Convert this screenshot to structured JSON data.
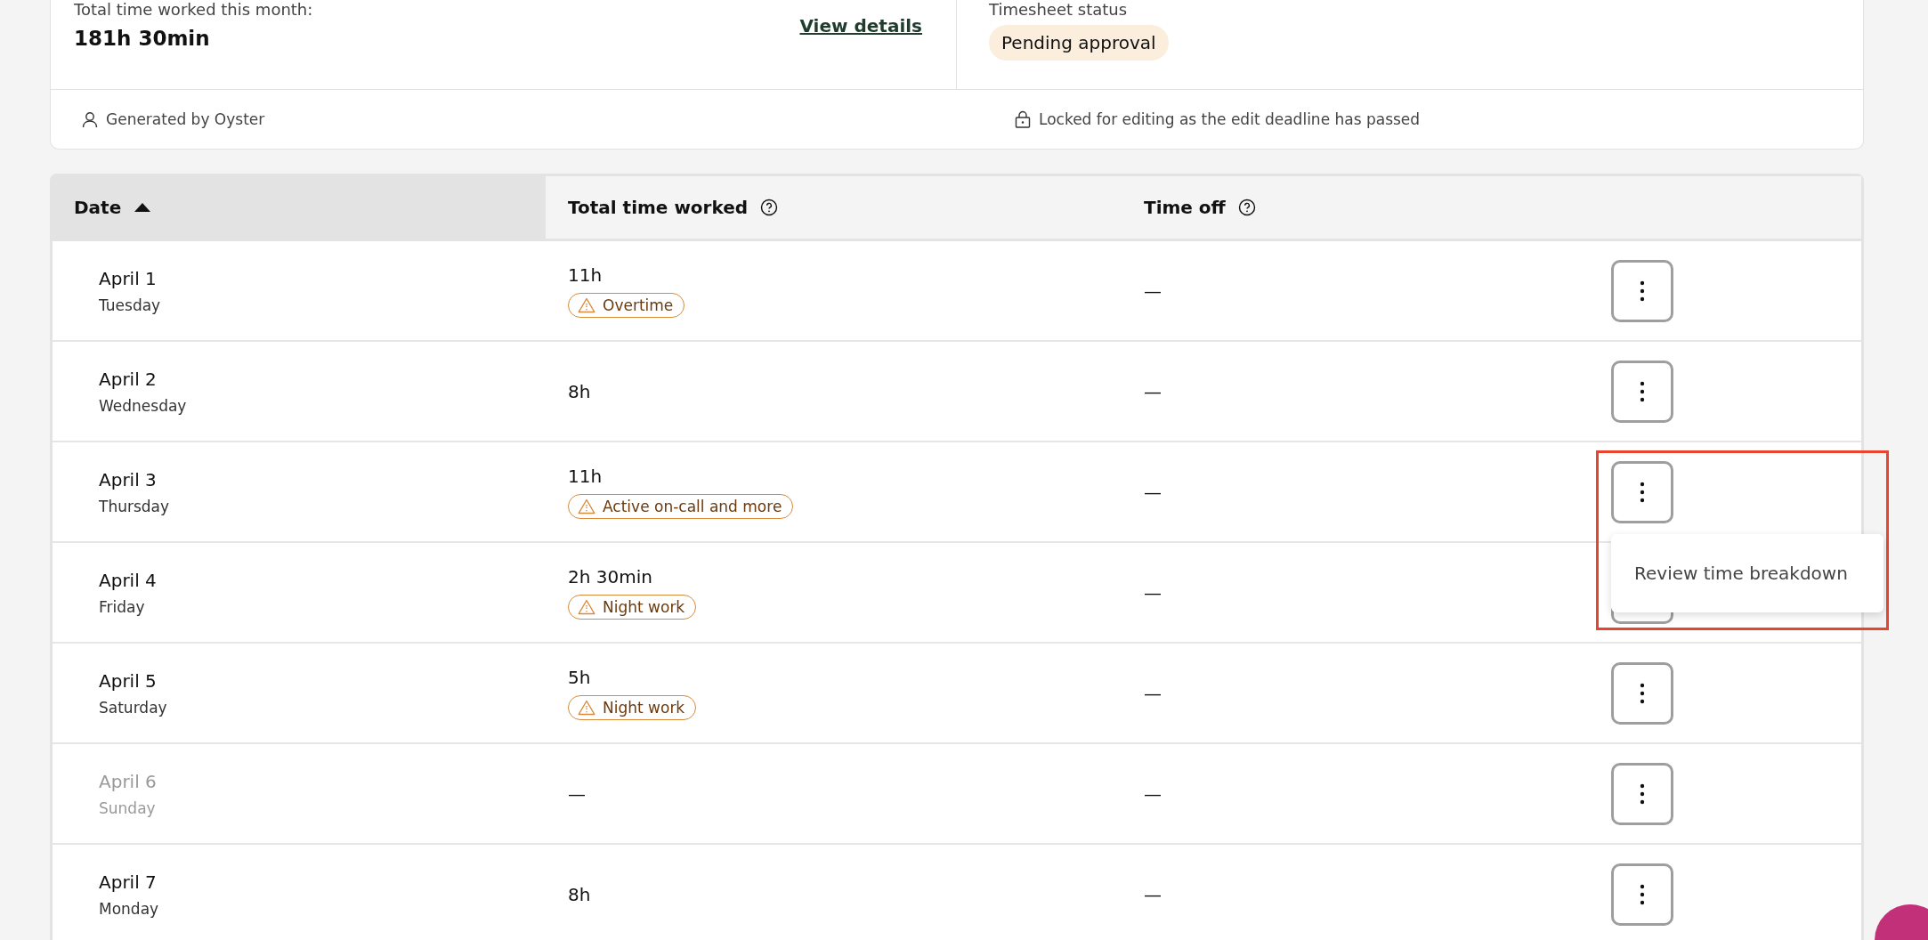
{
  "summary": {
    "total_label": "Total time worked this month:",
    "total_value": "181h 30min",
    "details_link": "View details",
    "status_label": "Timesheet status",
    "status_badge": "Pending approval",
    "generated_by": "Generated by Oyster",
    "lock_note": "Locked for editing as the edit deadline has passed"
  },
  "table": {
    "columns": [
      {
        "label": "Date",
        "sorted": true,
        "help": false
      },
      {
        "label": "Total time worked",
        "sorted": false,
        "help": true
      },
      {
        "label": "Time off",
        "sorted": false,
        "help": true
      }
    ],
    "rows": [
      {
        "date": "April 1",
        "weekday": "Tuesday",
        "worked": "11h",
        "tag": "Overtime",
        "time_off": "—",
        "disabled": false,
        "menu_open": false
      },
      {
        "date": "April 2",
        "weekday": "Wednesday",
        "worked": "8h",
        "time_off": "—",
        "disabled": false,
        "menu_open": false
      },
      {
        "date": "April 3",
        "weekday": "Thursday",
        "worked": "11h",
        "tag": "Active on-call and more",
        "time_off": "—",
        "disabled": false,
        "menu_open": true,
        "menu_items": [
          "Review time breakdown"
        ]
      },
      {
        "date": "April 4",
        "weekday": "Friday",
        "worked": "2h 30min",
        "tag": "Night work",
        "time_off": "—",
        "disabled": false,
        "menu_open": false
      },
      {
        "date": "April 5",
        "weekday": "Saturday",
        "worked": "5h",
        "tag": "Night work",
        "time_off": "—",
        "disabled": false,
        "menu_open": false
      },
      {
        "date": "April 6",
        "weekday": "Sunday",
        "worked": "—",
        "time_off": "—",
        "disabled": true,
        "menu_open": false
      },
      {
        "date": "April 7",
        "weekday": "Monday",
        "worked": "8h",
        "time_off": "—",
        "disabled": false,
        "menu_open": false
      }
    ]
  }
}
